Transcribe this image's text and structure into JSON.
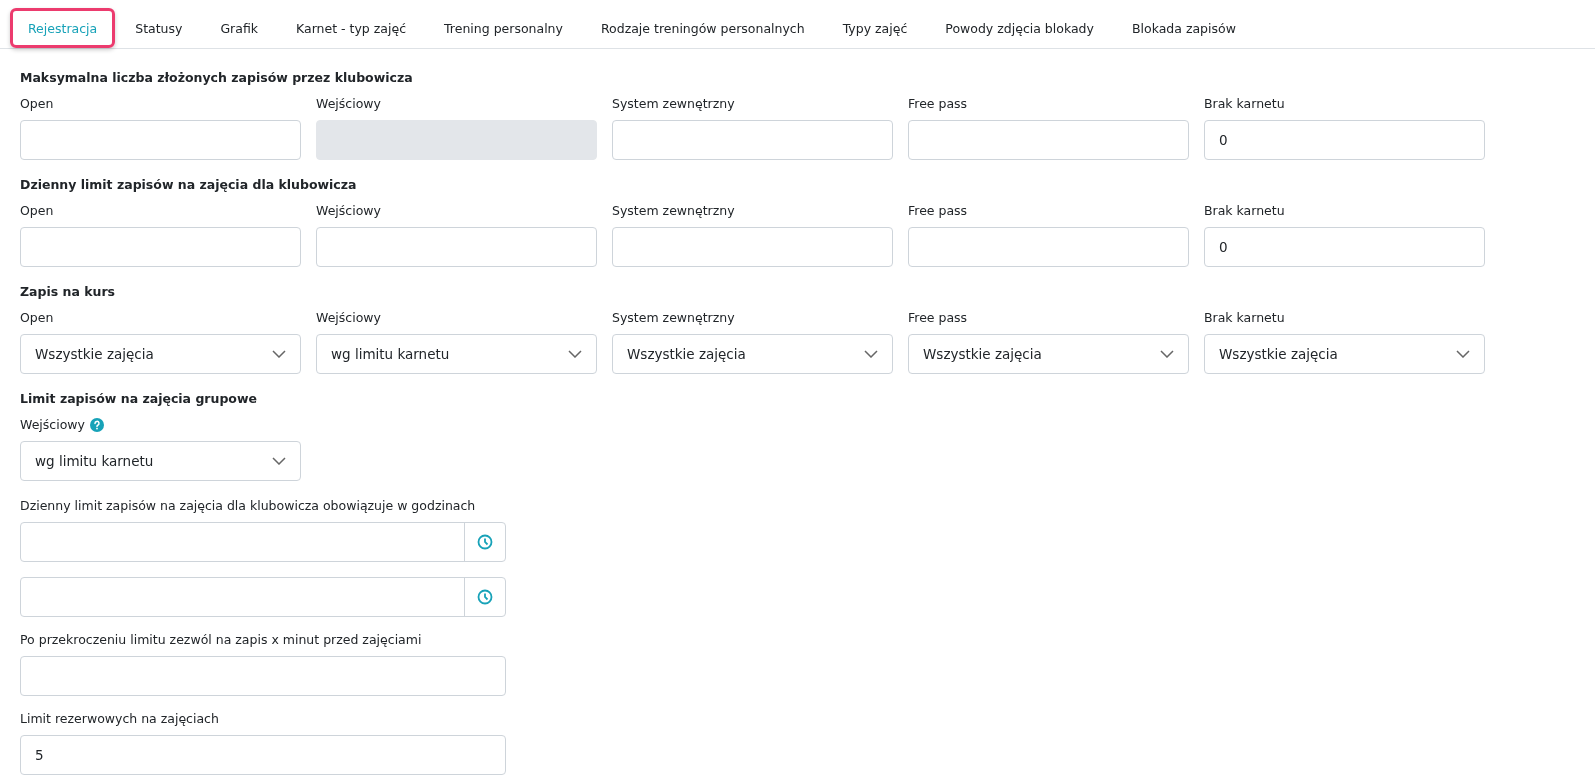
{
  "tabs": [
    {
      "label": "Rejestracja",
      "selected": true
    },
    {
      "label": "Statusy",
      "selected": false
    },
    {
      "label": "Grafik",
      "selected": false
    },
    {
      "label": "Karnet - typ zajęć",
      "selected": false
    },
    {
      "label": "Trening personalny",
      "selected": false
    },
    {
      "label": "Rodzaje treningów personalnych",
      "selected": false
    },
    {
      "label": "Typy zajęć",
      "selected": false
    },
    {
      "label": "Powody zdjęcia blokady",
      "selected": false
    },
    {
      "label": "Blokada zapisów",
      "selected": false
    }
  ],
  "sections": [
    {
      "title": "Maksymalna liczba złożonych zapisów przez klubowicza",
      "kind": "grid",
      "fields": [
        {
          "kind": "text",
          "label": "Open",
          "disabled": false
        },
        {
          "kind": "text",
          "label": "Wejściowy",
          "disabled": true
        },
        {
          "kind": "text",
          "label": "System zewnętrzny",
          "disabled": false
        },
        {
          "kind": "text",
          "label": "Free pass",
          "disabled": false
        },
        {
          "kind": "text",
          "label": "Brak karnetu",
          "value": "0",
          "disabled": false
        }
      ]
    },
    {
      "title": "Dzienny limit zapisów na zajęcia dla klubowicza",
      "kind": "grid",
      "fields": [
        {
          "kind": "text",
          "label": "Open",
          "disabled": false
        },
        {
          "kind": "text",
          "label": "Wejściowy",
          "disabled": false
        },
        {
          "kind": "text",
          "label": "System zewnętrzny",
          "disabled": false
        },
        {
          "kind": "text",
          "label": "Free pass",
          "disabled": false
        },
        {
          "kind": "text",
          "label": "Brak karnetu",
          "value": "0",
          "disabled": false
        }
      ]
    },
    {
      "title": "Zapis na kurs",
      "kind": "grid",
      "fields": [
        {
          "kind": "select",
          "label": "Open",
          "value": "Wszystkie zajęcia"
        },
        {
          "kind": "select",
          "label": "Wejściowy",
          "value": "wg limitu karnetu"
        },
        {
          "kind": "select",
          "label": "System zewnętrzny",
          "value": "Wszystkie zajęcia"
        },
        {
          "kind": "select",
          "label": "Free pass",
          "value": "Wszystkie zajęcia"
        },
        {
          "kind": "select",
          "label": "Brak karnetu",
          "value": "Wszystkie zajęcia"
        }
      ]
    },
    {
      "title": "Limit zapisów na zajęcia grupowe",
      "kind": "grid",
      "fields": [
        {
          "kind": "select",
          "label": "Wejściowy",
          "help": true,
          "value": "wg limitu karnetu"
        }
      ]
    },
    {
      "kind": "stack",
      "fields": [
        {
          "kind": "time",
          "label": "Dzienny limit zapisów na zajęcia dla klubowicza obowiązuje w godzinach",
          "disabled": false
        },
        {
          "kind": "time",
          "disabled": false
        },
        {
          "kind": "text",
          "label": "Po przekroczeniu limitu zezwól na zapis x minut przed zajęciami",
          "disabled": false
        },
        {
          "kind": "text",
          "label": "Limit rezerwowych na zajęciach",
          "value": "5",
          "disabled": false
        }
      ]
    }
  ]
}
